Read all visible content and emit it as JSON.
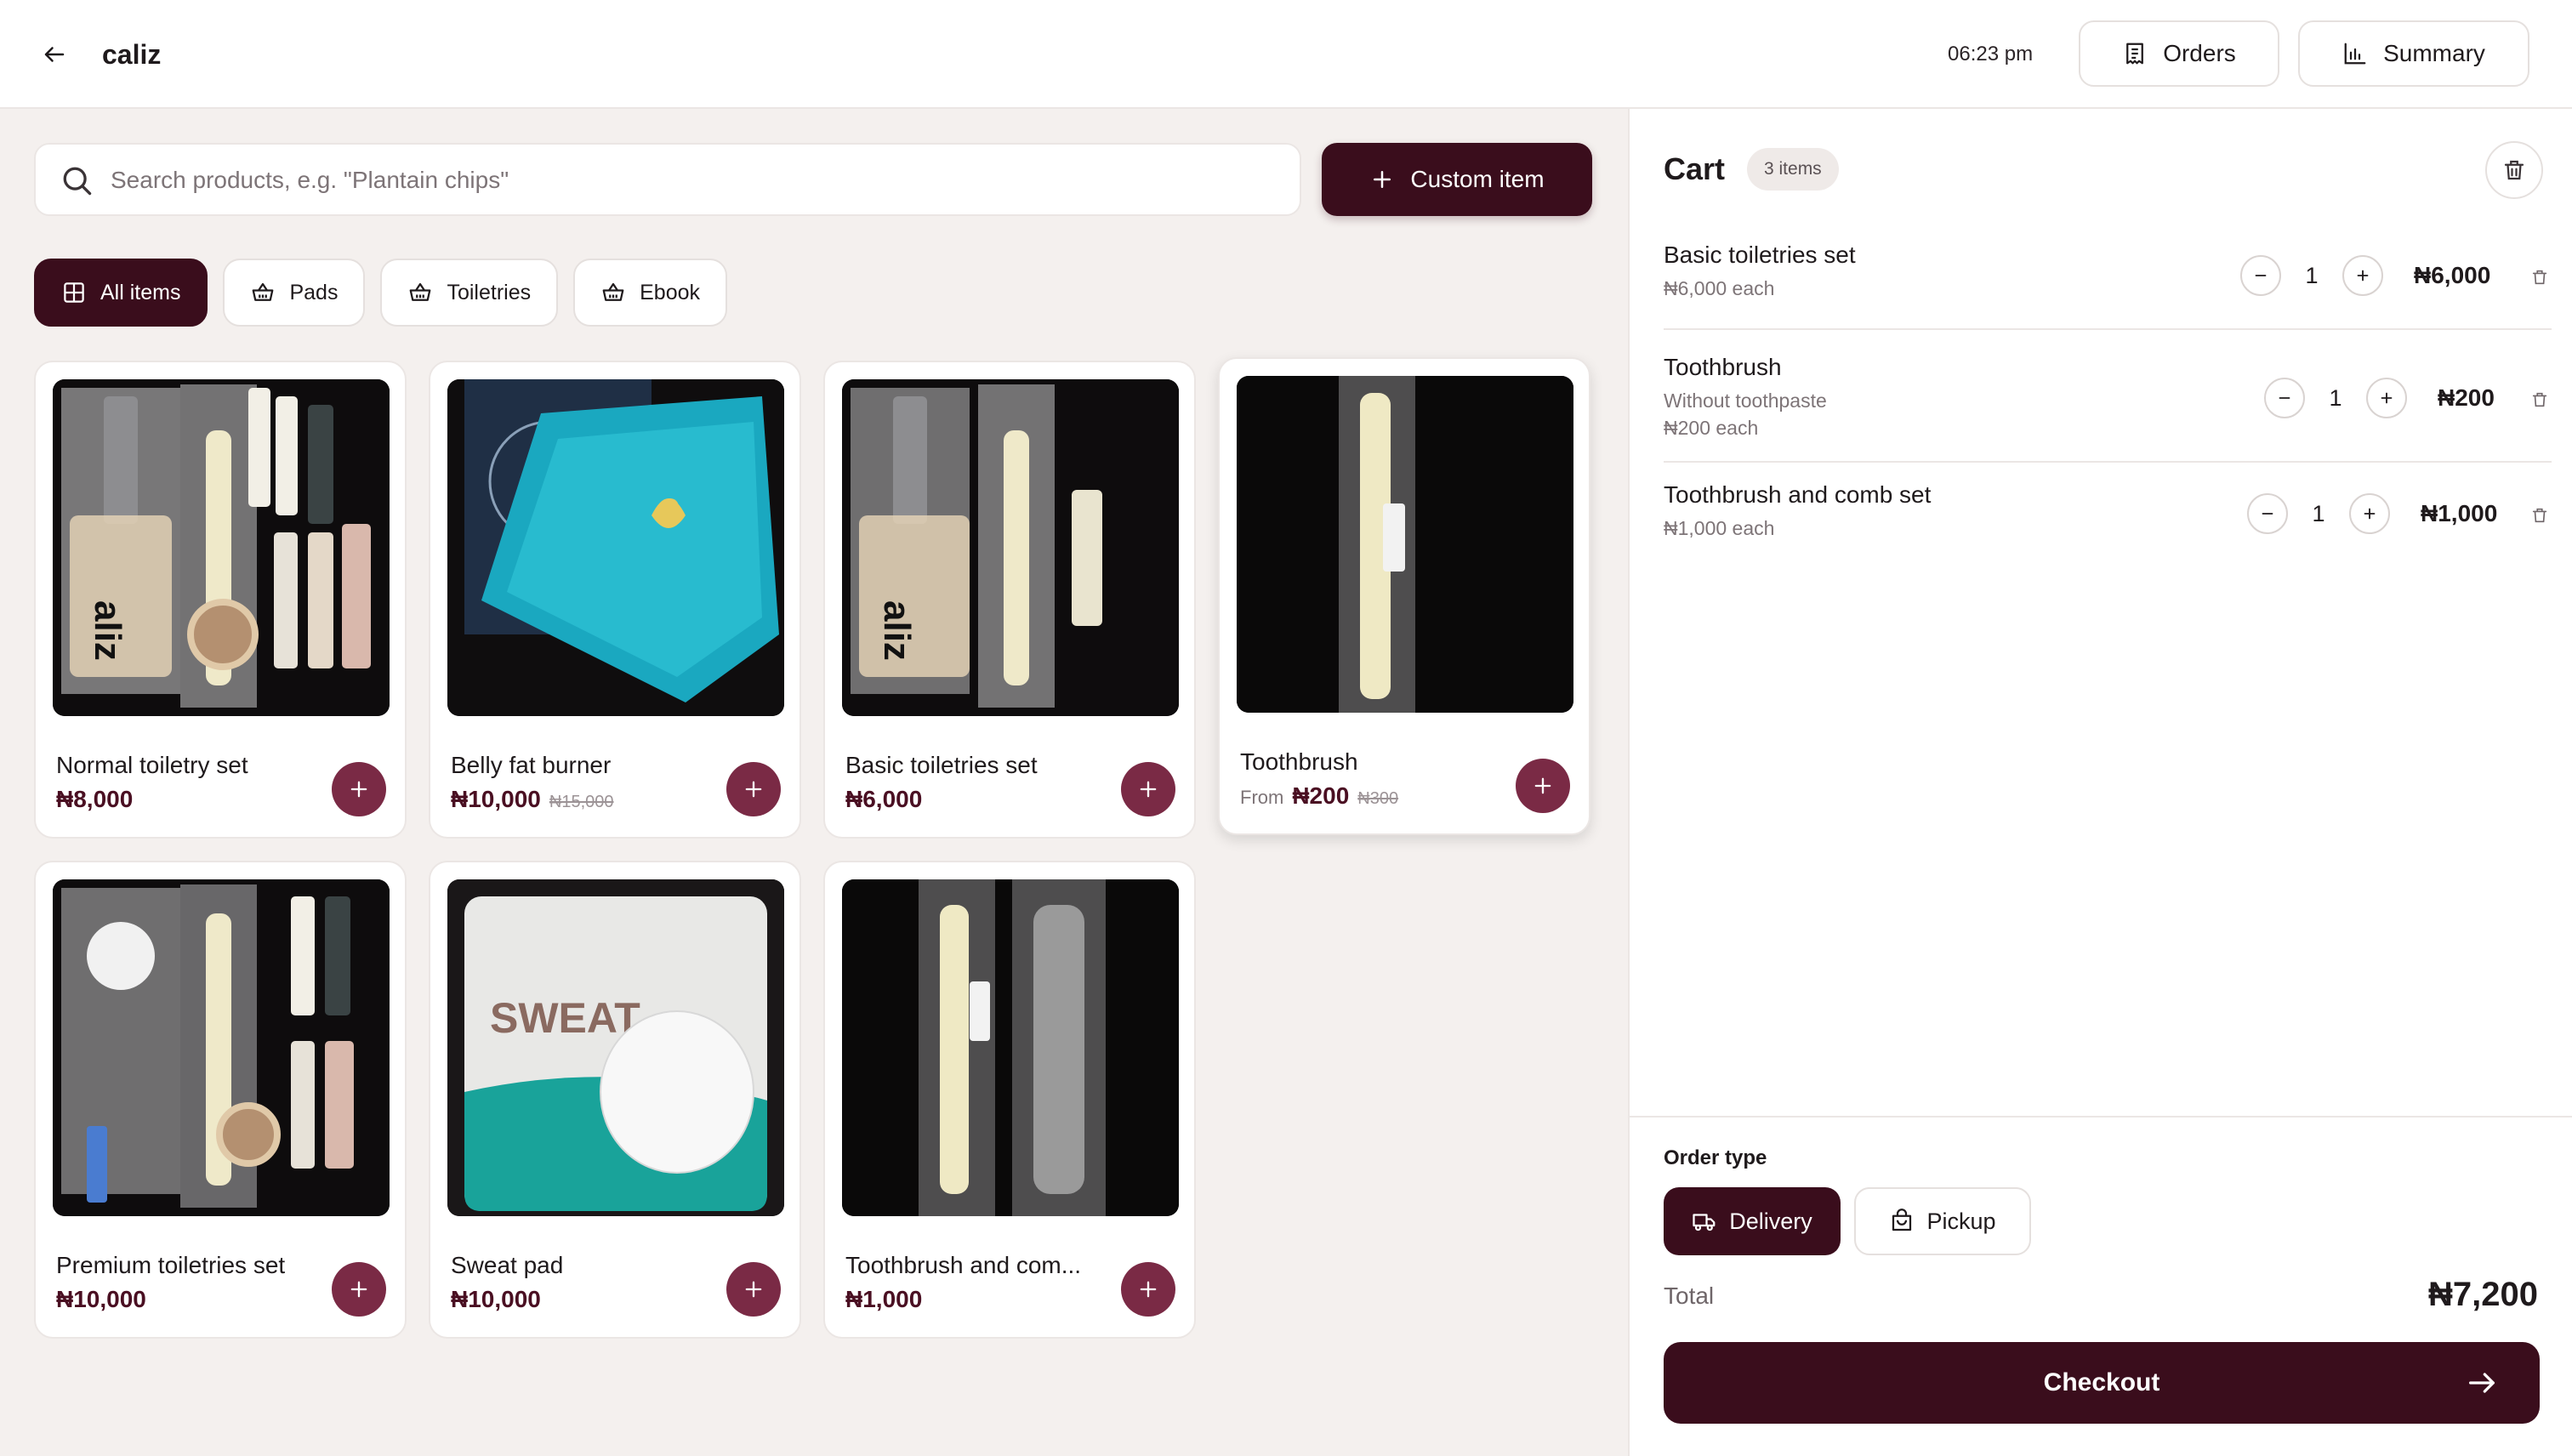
{
  "header": {
    "brand": "caliz",
    "time": "06:23 pm",
    "orders_label": "Orders",
    "summary_label": "Summary"
  },
  "search": {
    "placeholder": "Search products, e.g. \"Plantain chips\"",
    "value": ""
  },
  "custom_item_label": "Custom item",
  "categories": [
    {
      "label": "All items",
      "icon": "grid-icon",
      "active": true
    },
    {
      "label": "Pads",
      "icon": "basket-icon",
      "active": false
    },
    {
      "label": "Toiletries",
      "icon": "basket-icon",
      "active": false
    },
    {
      "label": "Ebook",
      "icon": "basket-icon",
      "active": false
    }
  ],
  "products": [
    {
      "name": "Normal toiletry set",
      "price": "₦8,000",
      "from": "",
      "old_price": ""
    },
    {
      "name": "Belly fat burner",
      "price": "₦10,000",
      "from": "",
      "old_price": "₦15,000"
    },
    {
      "name": "Basic toiletries set",
      "price": "₦6,000",
      "from": "",
      "old_price": ""
    },
    {
      "name": "Toothbrush",
      "price": "₦200",
      "from": "From",
      "old_price": "₦300"
    },
    {
      "name": "Premium toiletries set",
      "price": "₦10,000",
      "from": "",
      "old_price": ""
    },
    {
      "name": "Sweat pad",
      "price": "₦10,000",
      "from": "",
      "old_price": ""
    },
    {
      "name": "Toothbrush and com...",
      "price": "₦1,000",
      "from": "",
      "old_price": ""
    }
  ],
  "cart": {
    "title": "Cart",
    "count": "3 items",
    "items": [
      {
        "name": "Basic toiletries set",
        "variant": "",
        "each": "₦6,000 each",
        "qty": "1",
        "total": "₦6,000"
      },
      {
        "name": "Toothbrush",
        "variant": "Without toothpaste",
        "each": "₦200 each",
        "qty": "1",
        "total": "₦200"
      },
      {
        "name": "Toothbrush and comb set",
        "variant": "",
        "each": "₦1,000 each",
        "qty": "1",
        "total": "₦1,000"
      }
    ],
    "order_type_label": "Order type",
    "delivery_label": "Delivery",
    "pickup_label": "Pickup",
    "total_label": "Total",
    "total_value": "₦7,200",
    "checkout_label": "Checkout"
  },
  "colors": {
    "primary": "#3a0d1c",
    "accent": "#7a2a45",
    "background": "#f4f0ee"
  }
}
